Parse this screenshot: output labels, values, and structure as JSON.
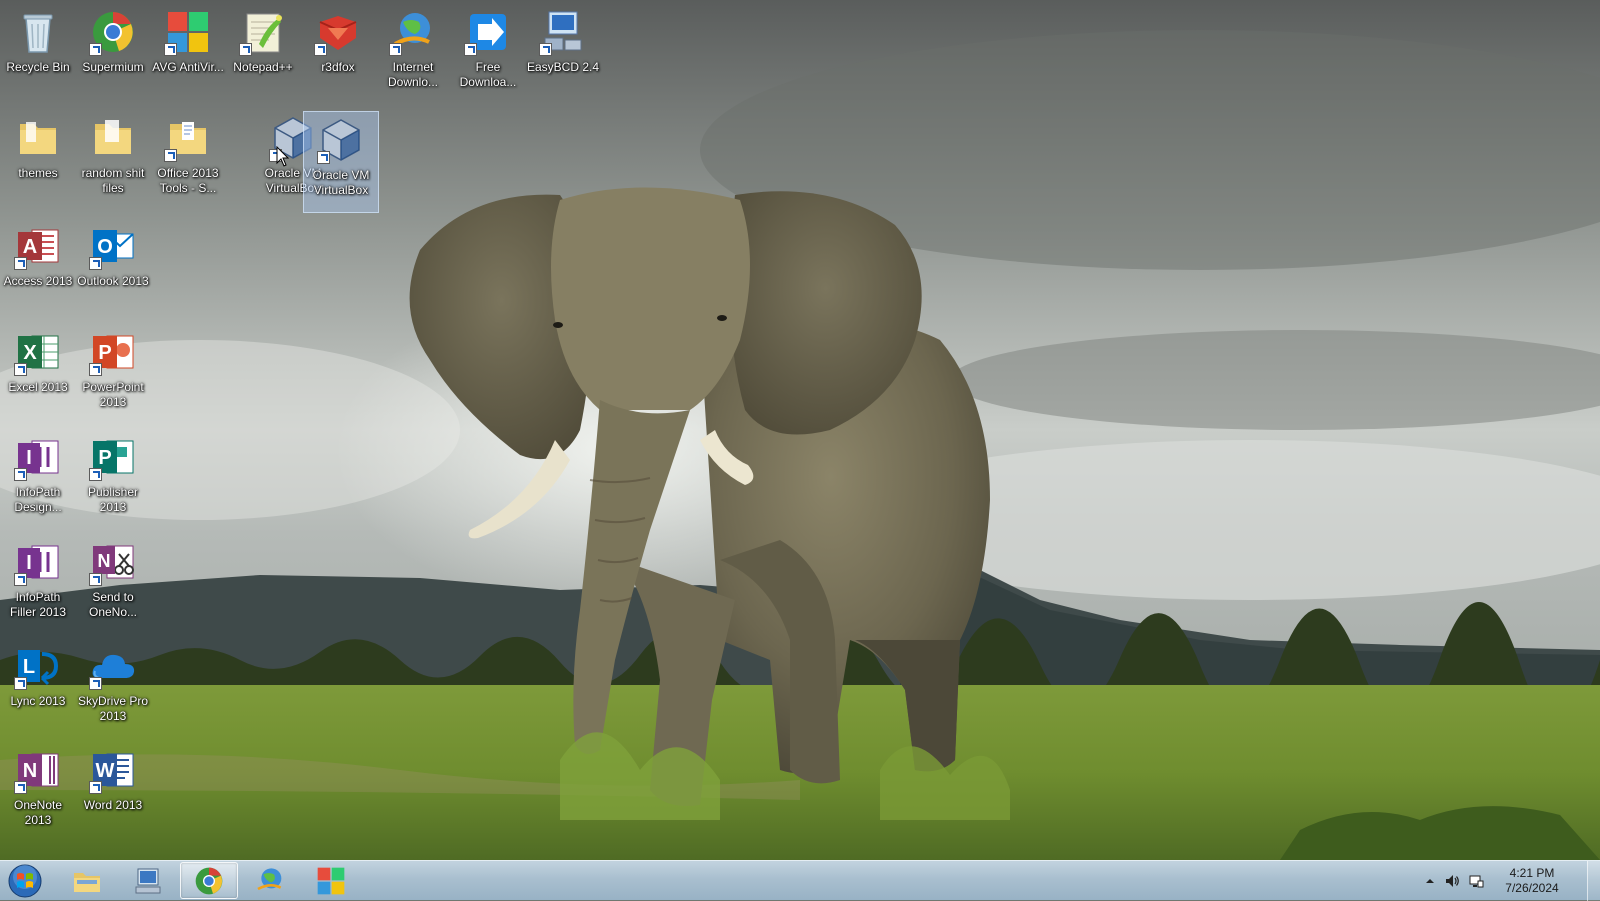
{
  "desktop": {
    "icons": [
      {
        "label": "Recycle Bin",
        "icon": "recycle-bin-icon"
      },
      {
        "label": "Supermium",
        "icon": "supermium-icon"
      },
      {
        "label": "AVG AntiVir...",
        "icon": "avg-antivirus-icon"
      },
      {
        "label": "Notepad++",
        "icon": "notepad-plus-plus-icon"
      },
      {
        "label": "r3dfox",
        "icon": "r3dfox-icon"
      },
      {
        "label": "Internet Downlo...",
        "icon": "internet-download-manager-icon"
      },
      {
        "label": "Free Downloa...",
        "icon": "free-download-manager-icon"
      },
      {
        "label": "EasyBCD 2.4",
        "icon": "easybcd-icon"
      },
      {
        "label": "themes",
        "icon": "folder-icon"
      },
      {
        "label": "random shit files",
        "icon": "folder-icon"
      },
      {
        "label": "Office 2013 Tools - S...",
        "icon": "office-tools-folder-icon"
      },
      {
        "label": "Oracle VM VirtualBox",
        "icon": "virtualbox-icon"
      },
      {
        "label": "Oracle VM VirtualBox",
        "icon": "virtualbox-icon"
      },
      {
        "label": "Access 2013",
        "icon": "access-icon"
      },
      {
        "label": "Outlook 2013",
        "icon": "outlook-icon"
      },
      {
        "label": "Excel 2013",
        "icon": "excel-icon"
      },
      {
        "label": "PowerPoint 2013",
        "icon": "powerpoint-icon"
      },
      {
        "label": "InfoPath Design...",
        "icon": "infopath-designer-icon"
      },
      {
        "label": "Publisher 2013",
        "icon": "publisher-icon"
      },
      {
        "label": "InfoPath Filler 2013",
        "icon": "infopath-filler-icon"
      },
      {
        "label": "Send to OneNo...",
        "icon": "send-to-onenote-icon"
      },
      {
        "label": "Lync 2013",
        "icon": "lync-icon"
      },
      {
        "label": "SkyDrive Pro 2013",
        "icon": "skydrive-pro-icon"
      },
      {
        "label": "OneNote 2013",
        "icon": "onenote-icon"
      },
      {
        "label": "Word 2013",
        "icon": "word-icon"
      }
    ]
  },
  "taskbar": {
    "start": "windows-start-orb-icon",
    "pinned": [
      {
        "icon": "file-explorer-icon",
        "active": false
      },
      {
        "icon": "this-pc-icon",
        "active": false
      },
      {
        "icon": "supermium-icon",
        "active": true
      },
      {
        "icon": "internet-download-manager-icon",
        "active": false
      },
      {
        "icon": "avg-antivirus-icon",
        "active": false
      }
    ],
    "tray": {
      "icons": [
        "show-hidden-icons-chevron-icon",
        "volume-icon",
        "network-icon"
      ],
      "time": "4:21 PM",
      "date": "7/26/2024"
    }
  },
  "colors": {
    "taskbar": "#a9bfcf",
    "selection": "#aac8f0"
  }
}
